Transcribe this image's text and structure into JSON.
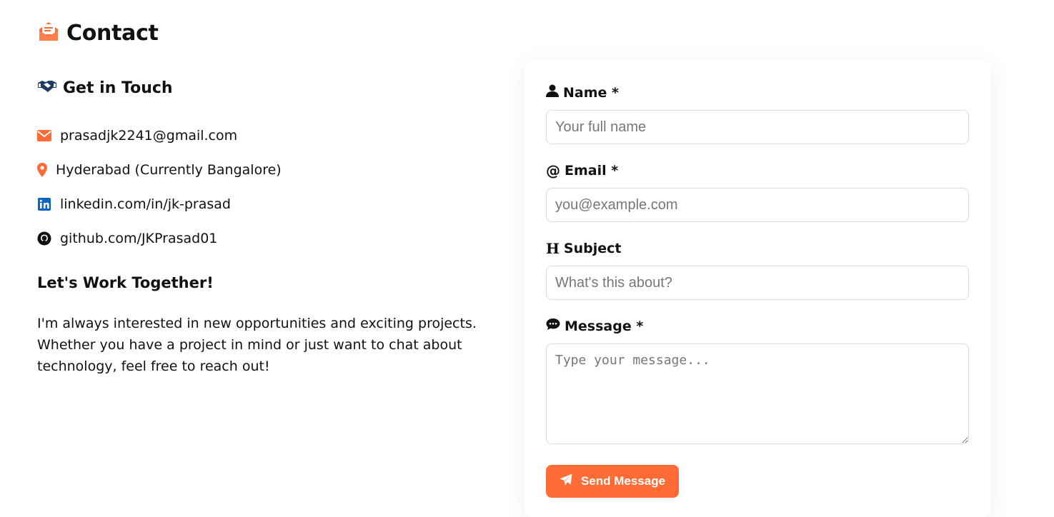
{
  "page": {
    "title": "Contact",
    "accent": "#ff6b35"
  },
  "left": {
    "heading": "Get in Touch",
    "contacts": [
      {
        "icon": "envelope-icon",
        "text": "prasadjk2241@gmail.com"
      },
      {
        "icon": "location-pin-icon",
        "text": "Hyderabad (Currently Bangalore)"
      },
      {
        "icon": "linkedin-icon",
        "text": "linkedin.com/in/jk-prasad"
      },
      {
        "icon": "github-icon",
        "text": "github.com/JKPrasad01"
      }
    ],
    "work_title": "Let's Work Together!",
    "paragraph": "I'm always interested in new opportunities and exciting projects. Whether you have a project in mind or just want to chat about technology, feel free to reach out!"
  },
  "form": {
    "name": {
      "label": "Name *",
      "placeholder": "Your full name",
      "value": ""
    },
    "email": {
      "label": "Email *",
      "placeholder": "you@example.com",
      "value": ""
    },
    "subject": {
      "label": "Subject",
      "placeholder": "What's this about?",
      "value": ""
    },
    "message": {
      "label": "Message *",
      "placeholder": "Type your message...",
      "value": ""
    },
    "submit_label": "Send Message"
  }
}
